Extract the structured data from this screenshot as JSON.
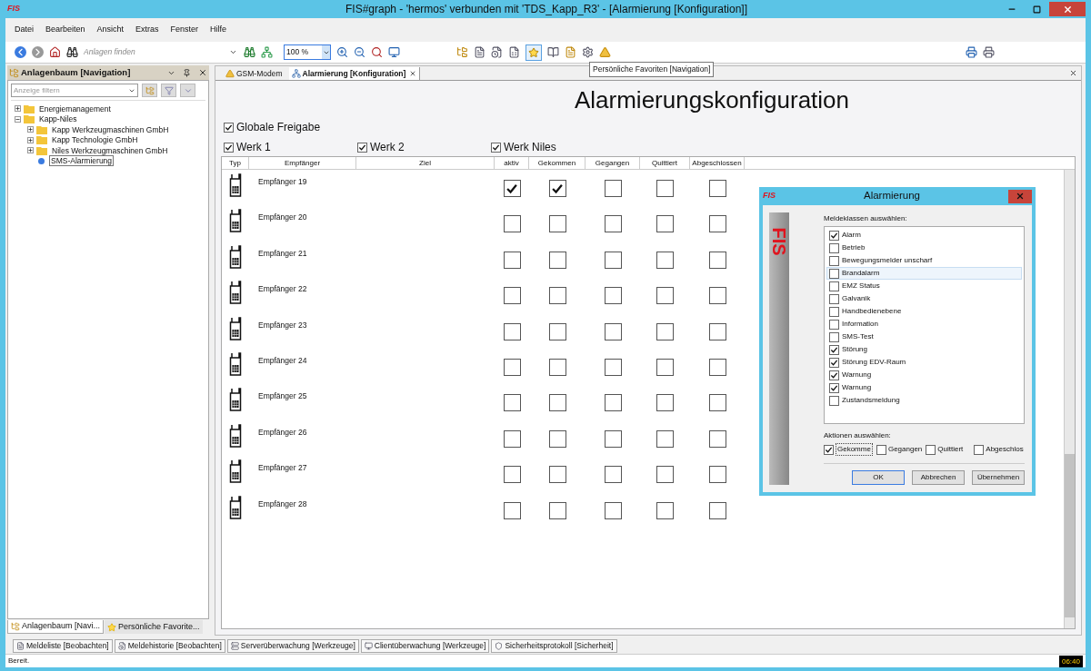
{
  "window": {
    "logo": "FIS",
    "title": "FIS#graph - 'hermos' verbunden mit 'TDS_Kapp_R3' - [Alarmierung [Konfiguration]]"
  },
  "menu": [
    "Datei",
    "Bearbeiten",
    "Ansicht",
    "Extras",
    "Fenster",
    "Hilfe"
  ],
  "toolbar": {
    "search_placeholder": "Anlagen finden",
    "zoom": "100 %",
    "tooltip": "Persönliche Favoriten [Navigation]"
  },
  "left_panel": {
    "title": "Anlagenbaum [Navigation]",
    "filter_placeholder": "Anzeige filtern",
    "tree": [
      {
        "label": "Energiemanagement",
        "kind": "folder",
        "expanded": false,
        "selected": false
      },
      {
        "label": "Kapp-Niles",
        "kind": "folder",
        "expanded": true,
        "selected": false,
        "children": [
          {
            "label": "Kapp Werkzeugmaschinen GmbH",
            "kind": "folder",
            "expanded": false,
            "selected": false
          },
          {
            "label": "Kapp Technologie GmbH",
            "kind": "folder",
            "expanded": false,
            "selected": false
          },
          {
            "label": "Niles Werkzeugmaschinen GmbH",
            "kind": "folder",
            "expanded": false,
            "selected": false
          },
          {
            "label": "SMS-Alarmierung",
            "kind": "alarm",
            "selected": true
          }
        ]
      }
    ],
    "tabs": [
      {
        "label": "Anlagenbaum [Navi...",
        "kind": "tree",
        "selected": true
      },
      {
        "label": "Persönliche Favorite...",
        "kind": "star",
        "selected": false
      }
    ]
  },
  "document_tabs": [
    {
      "label": "GSM-Modem",
      "kind": "modem",
      "selected": false
    },
    {
      "label": "Alarmierung [Konfiguration]",
      "kind": "config",
      "selected": true
    }
  ],
  "heading": "Alarmierungskonfiguration",
  "global_release": {
    "label": "Globale Freigabe",
    "checked": true
  },
  "plants": [
    {
      "label": "Werk 1",
      "checked": true
    },
    {
      "label": "Werk 2",
      "checked": true
    },
    {
      "label": "Werk Niles",
      "checked": true
    }
  ],
  "table": {
    "columns": [
      "Typ",
      "Empfänger",
      "Ziel",
      "aktiv",
      "Gekommen",
      "Gegangen",
      "Quittiert",
      "Abgeschlossen"
    ],
    "rows": [
      {
        "recipient": "Empfänger 19",
        "checks": [
          true,
          true,
          false,
          false,
          false
        ]
      },
      {
        "recipient": "Empfänger 20",
        "checks": [
          false,
          false,
          false,
          false,
          false
        ]
      },
      {
        "recipient": "Empfänger 21",
        "checks": [
          false,
          false,
          false,
          false,
          false
        ]
      },
      {
        "recipient": "Empfänger 22",
        "checks": [
          false,
          false,
          false,
          false,
          false
        ]
      },
      {
        "recipient": "Empfänger 23",
        "checks": [
          false,
          false,
          false,
          false,
          false
        ]
      },
      {
        "recipient": "Empfänger 24",
        "checks": [
          false,
          false,
          false,
          false,
          false
        ]
      },
      {
        "recipient": "Empfänger 25",
        "checks": [
          false,
          false,
          false,
          false,
          false
        ]
      },
      {
        "recipient": "Empfänger 26",
        "checks": [
          false,
          false,
          false,
          false,
          false
        ]
      },
      {
        "recipient": "Empfänger 27",
        "checks": [
          false,
          false,
          false,
          false,
          false
        ]
      },
      {
        "recipient": "Empfänger 28",
        "checks": [
          false,
          false,
          false,
          false,
          false
        ]
      }
    ]
  },
  "dialog": {
    "logo": "FIS",
    "side_logo": "FIS",
    "title": "Alarmierung",
    "classes_label": "Meldeklassen auswählen:",
    "classes": [
      {
        "label": "Alarm",
        "checked": true,
        "selected": false
      },
      {
        "label": "Betrieb",
        "checked": false,
        "selected": false
      },
      {
        "label": "Bewegungsmelder unscharf",
        "checked": false,
        "selected": false
      },
      {
        "label": "Brandalarm",
        "checked": false,
        "selected": true
      },
      {
        "label": "EMZ Status",
        "checked": false,
        "selected": false
      },
      {
        "label": "Galvanik",
        "checked": false,
        "selected": false
      },
      {
        "label": "Handbedienebene",
        "checked": false,
        "selected": false
      },
      {
        "label": "Information",
        "checked": false,
        "selected": false
      },
      {
        "label": "SMS-Test",
        "checked": false,
        "selected": false
      },
      {
        "label": "Störung",
        "checked": true,
        "selected": false
      },
      {
        "label": "Störung EDV-Raum",
        "checked": true,
        "selected": false
      },
      {
        "label": "Warnung",
        "checked": true,
        "selected": false
      },
      {
        "label": "Warnung",
        "checked": true,
        "selected": false
      },
      {
        "label": "Zustandsmeldung",
        "checked": false,
        "selected": false
      }
    ],
    "actions_label": "Aktionen auswählen:",
    "actions": [
      {
        "label": "Gekomme",
        "checked": true
      },
      {
        "label": "Gegangen",
        "checked": false
      },
      {
        "label": "Quittiert",
        "checked": false
      },
      {
        "label": "Abgeschlos",
        "checked": false
      }
    ],
    "buttons": [
      "OK",
      "Abbrechen",
      "Übernehmen"
    ]
  },
  "window_tabs": [
    "Meldeliste [Beobachten]",
    "Meldehistorie [Beobachten]",
    "Serverüberwachung [Werkzeuge]",
    "Clientüberwachung [Werkzeuge]",
    "Sicherheitsprotokoll [Sicherheit]"
  ],
  "status": {
    "text": "Bereit.",
    "time": "06:40"
  }
}
